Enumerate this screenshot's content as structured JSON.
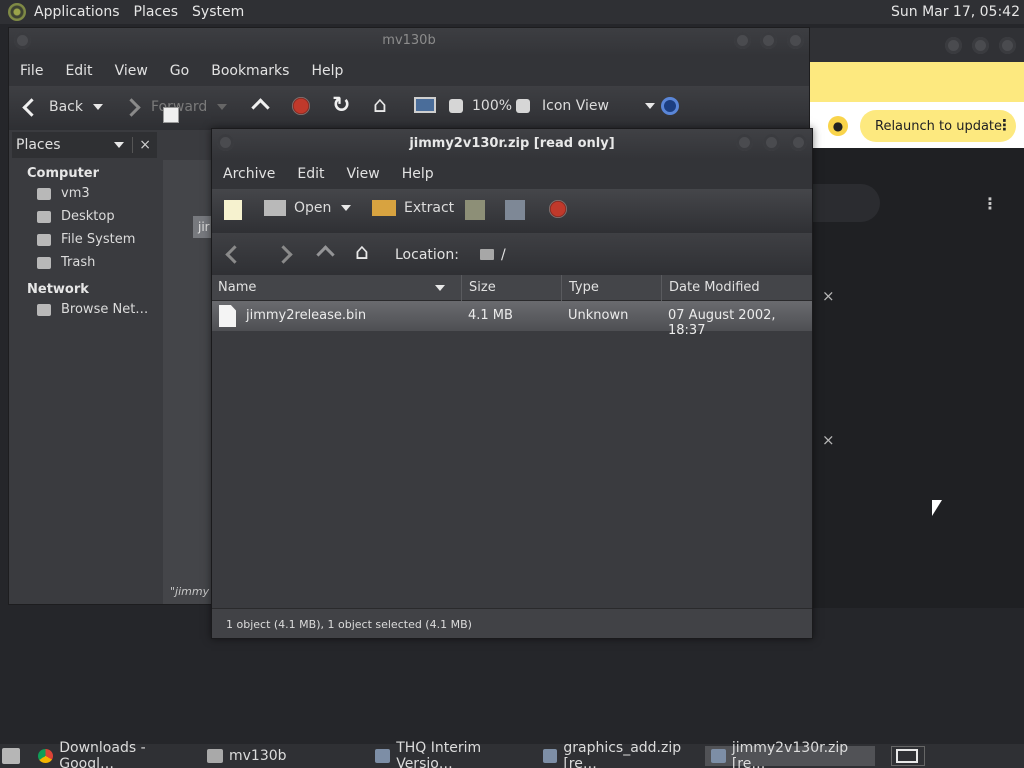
{
  "top_panel": {
    "menus": [
      "Applications",
      "Places",
      "System"
    ],
    "clock": "Sun Mar 17, 05:42"
  },
  "chrome_window": {
    "relaunch_label": "Relaunch to update",
    "more_glyph": "⋮",
    "close_glyph": "×",
    "banner_color": "#fde97f"
  },
  "file_manager": {
    "title": "mv130b",
    "menus": [
      "File",
      "Edit",
      "View",
      "Go",
      "Bookmarks",
      "Help"
    ],
    "toolbar": {
      "back_label": "Back",
      "forward_label": "Forward",
      "zoom_level": "100%",
      "view_mode": "Icon View"
    },
    "sidebar": {
      "header": "Places",
      "close_glyph": "×",
      "sections": [
        {
          "title": "Computer",
          "items": [
            "vm3",
            "Desktop",
            "File System",
            "Trash"
          ]
        },
        {
          "title": "Network",
          "items": [
            "Browse Net…"
          ]
        }
      ]
    },
    "content": {
      "file_label_fragment": "jir",
      "status_fragment": "\"jimmy"
    }
  },
  "archive_window": {
    "title": "jimmy2v130r.zip [read only]",
    "menus": [
      "Archive",
      "Edit",
      "View",
      "Help"
    ],
    "toolbar": {
      "open_label": "Open",
      "extract_label": "Extract"
    },
    "location": {
      "label": "Location:",
      "path": "/"
    },
    "columns": [
      "Name",
      "Size",
      "Type",
      "Date Modified"
    ],
    "files": [
      {
        "name": "jimmy2release.bin",
        "size": "4.1 MB",
        "type": "Unknown",
        "modified": "07 August 2002, 18:37"
      }
    ],
    "status": "1 object (4.1 MB), 1 object selected (4.1 MB)"
  },
  "taskbar": {
    "tasks": [
      {
        "label": "Downloads - Googl…",
        "icon": "chrome-icon"
      },
      {
        "label": "mv130b",
        "icon": "folder-icon"
      },
      {
        "label": "THQ Interim Versio…",
        "icon": "archive-icon"
      },
      {
        "label": "graphics_add.zip [re…",
        "icon": "archive-icon"
      },
      {
        "label": "jimmy2v130r.zip [re…",
        "icon": "archive-icon"
      }
    ]
  }
}
